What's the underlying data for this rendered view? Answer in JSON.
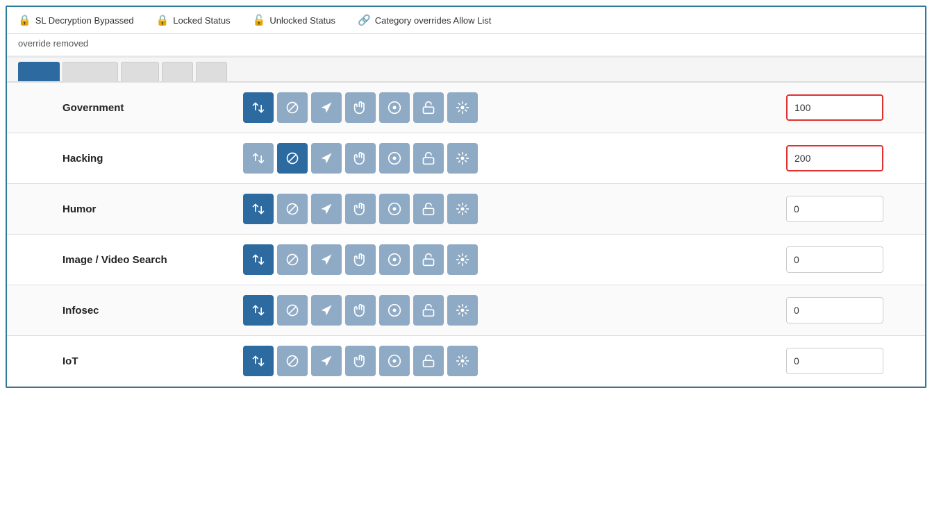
{
  "legend": {
    "items": [
      {
        "id": "ssl-bypassed",
        "icon": "🔒",
        "label": "SL Decryption Bypassed"
      },
      {
        "id": "locked-status",
        "icon": "🔒",
        "label": "Locked Status"
      },
      {
        "id": "unlocked-status",
        "icon": "🔓",
        "label": "Unlocked Status"
      },
      {
        "id": "category-overrides",
        "icon": "🔗",
        "label": "Category overrides Allow List"
      }
    ]
  },
  "notice": "override removed",
  "tabs": [
    {
      "id": "tab1",
      "label": "———",
      "active": false
    },
    {
      "id": "tab2",
      "label": "————",
      "active": true
    },
    {
      "id": "tab3",
      "label": "———",
      "active": false
    },
    {
      "id": "tab4",
      "label": "——",
      "active": false
    },
    {
      "id": "tab5",
      "label": "——",
      "active": false
    }
  ],
  "rows": [
    {
      "id": "government",
      "label": "Government",
      "activeButton": 0,
      "value": "100",
      "highlighted": true
    },
    {
      "id": "hacking",
      "label": "Hacking",
      "activeButton": 1,
      "value": "200",
      "highlighted": true
    },
    {
      "id": "humor",
      "label": "Humor",
      "activeButton": 0,
      "value": "0",
      "highlighted": false
    },
    {
      "id": "image-video-search",
      "label": "Image / Video Search",
      "activeButton": 0,
      "value": "0",
      "highlighted": false
    },
    {
      "id": "infosec",
      "label": "Infosec",
      "activeButton": 0,
      "value": "0",
      "highlighted": false
    },
    {
      "id": "iot",
      "label": "IoT",
      "activeButton": 0,
      "value": "0",
      "highlighted": false
    }
  ],
  "buttons": [
    {
      "id": "transfer",
      "title": "Transfer"
    },
    {
      "id": "block",
      "title": "Block"
    },
    {
      "id": "bypass",
      "title": "Bypass/Plane"
    },
    {
      "id": "hand",
      "title": "Hand/Allow"
    },
    {
      "id": "monitor",
      "title": "Monitor/Eye"
    },
    {
      "id": "unlock",
      "title": "Unlock"
    },
    {
      "id": "override",
      "title": "Override"
    }
  ]
}
